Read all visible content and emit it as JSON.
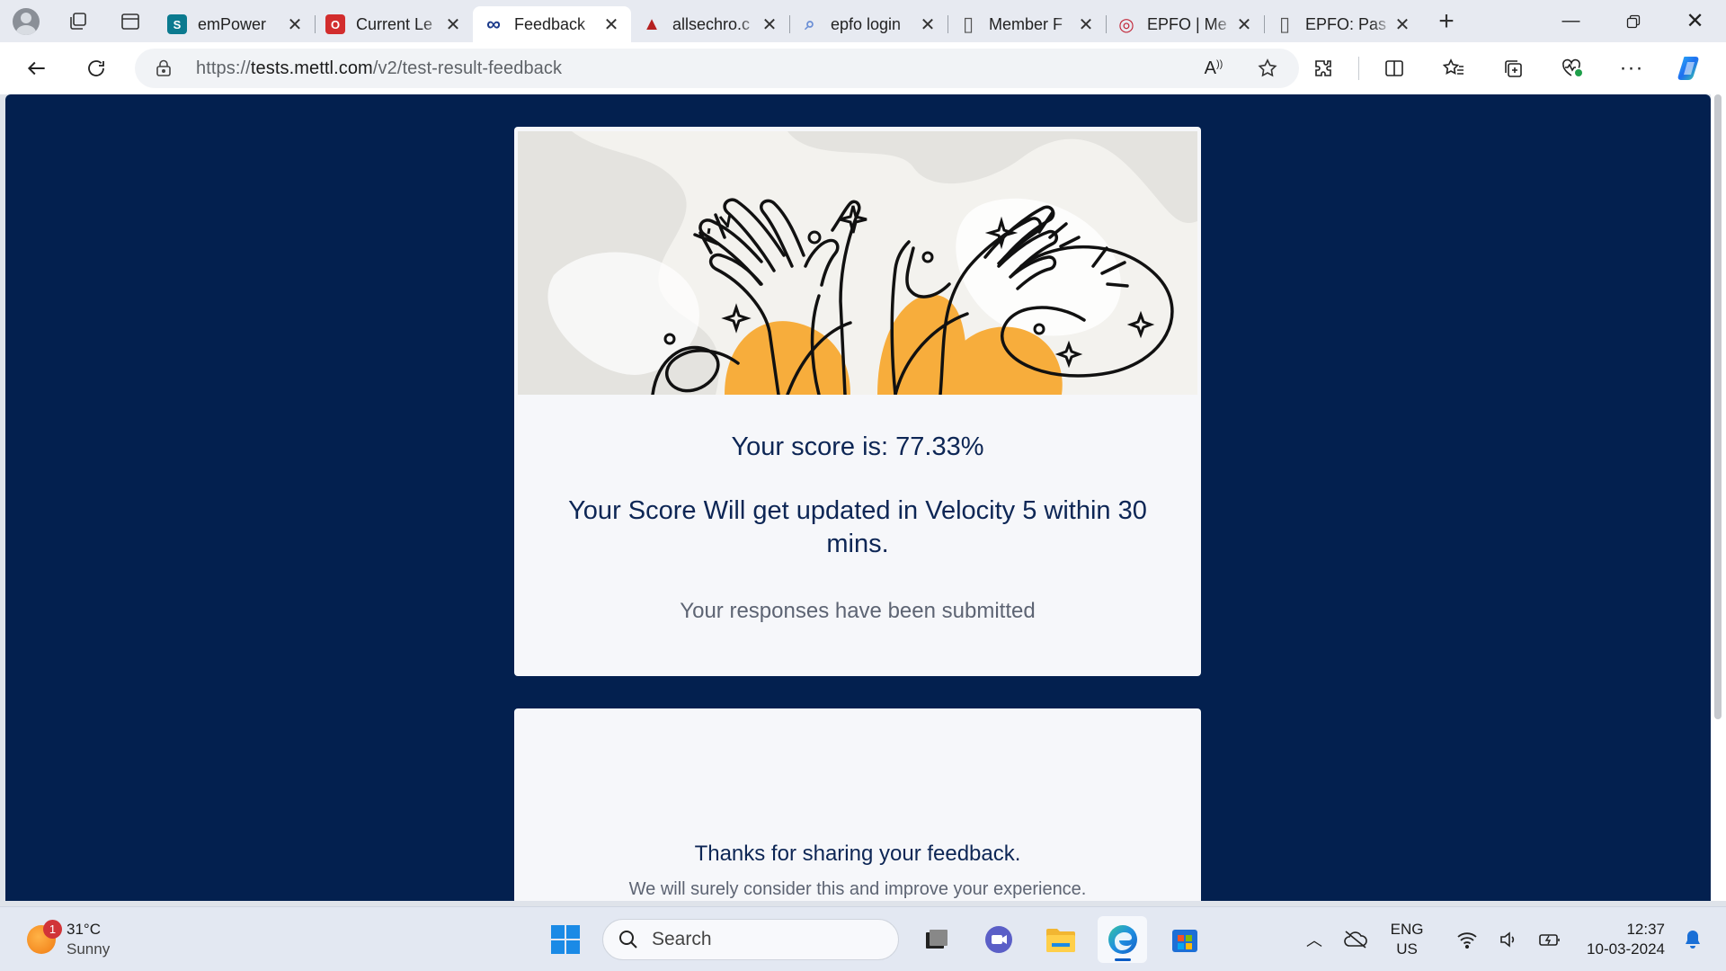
{
  "browser": {
    "tabs": [
      {
        "title": "emPower",
        "active": false,
        "favicon_color": "#0b7a8f",
        "favicon_glyph": "S"
      },
      {
        "title": "Current Le",
        "active": false,
        "favicon_color": "#d22d2d",
        "favicon_glyph": "O"
      },
      {
        "title": "Feedback",
        "active": true,
        "favicon_color": "#1b3a8a",
        "favicon_glyph": "∞"
      },
      {
        "title": "allsechro.c",
        "active": false,
        "favicon_color": "#b52020",
        "favicon_glyph": "▲"
      },
      {
        "title": "epfo login",
        "active": false,
        "favicon_color": "#6b8fd6",
        "favicon_glyph": "⌕"
      },
      {
        "title": "Member F",
        "active": false,
        "favicon_color": "#666666",
        "favicon_glyph": "▯"
      },
      {
        "title": "EPFO | Me",
        "active": false,
        "favicon_color": "#c2283a",
        "favicon_glyph": "◎"
      },
      {
        "title": "EPFO: Pas",
        "active": false,
        "favicon_color": "#666666",
        "favicon_glyph": "▯"
      }
    ],
    "url_prefix": "https://",
    "url_host": "tests.mettl.com",
    "url_path": "/v2/test-result-feedback"
  },
  "page": {
    "score_text": "Your score is: 77.33%",
    "update_text": "Your Score Will get updated in Velocity 5 within 30 mins.",
    "submitted_text": "Your responses have been submitted",
    "thanks_text": "Thanks for sharing your feedback.",
    "consider_text": "We will surely consider this and improve your experience."
  },
  "taskbar": {
    "weather_temp": "31°C",
    "weather_cond": "Sunny",
    "weather_badge": "1",
    "search_label": "Search",
    "lang_top": "ENG",
    "lang_bottom": "US",
    "time": "12:37",
    "date": "10-03-2024"
  },
  "colors": {
    "page_background": "#03204f",
    "heading_text": "#0d2655",
    "accent_orange": "#f7ad3c",
    "card_background": "#f6f7fa"
  }
}
